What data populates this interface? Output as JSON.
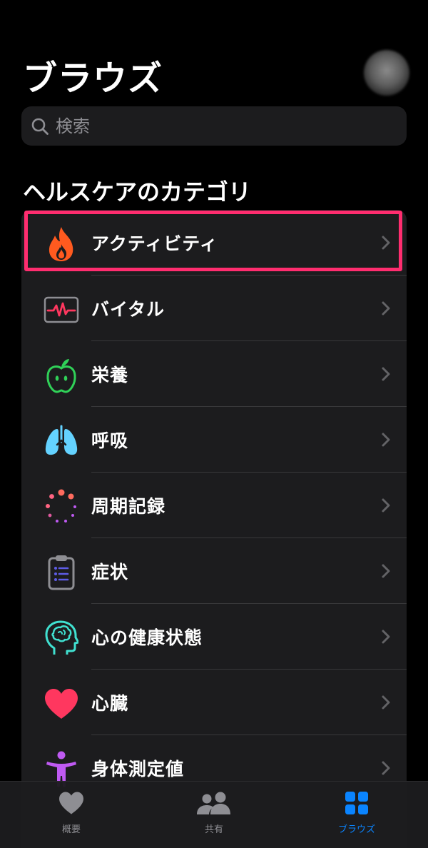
{
  "header": {
    "title": "ブラウズ"
  },
  "search": {
    "placeholder": "検索"
  },
  "section": {
    "title": "ヘルスケアのカテゴリ"
  },
  "categories": [
    {
      "label": "アクティビティ",
      "icon": "flame-icon",
      "color": "#ff5a1f"
    },
    {
      "label": "バイタル",
      "icon": "vitals-icon",
      "color": "#ff375f"
    },
    {
      "label": "栄養",
      "icon": "apple-icon",
      "color": "#30d158"
    },
    {
      "label": "呼吸",
      "icon": "lungs-icon",
      "color": "#64d2ff"
    },
    {
      "label": "周期記録",
      "icon": "cycle-tracking-icon",
      "color": "#ff6482"
    },
    {
      "label": "症状",
      "icon": "clipboard-list-icon",
      "color": "#5e5ce6"
    },
    {
      "label": "心の健康状態",
      "icon": "head-brain-icon",
      "color": "#40e0d0"
    },
    {
      "label": "心臓",
      "icon": "heart-icon",
      "color": "#ff375f"
    },
    {
      "label": "身体測定値",
      "icon": "person-icon",
      "color": "#bf5af2"
    }
  ],
  "tabbar": {
    "tabs": [
      {
        "label": "概要",
        "icon": "heart-icon",
        "active": false
      },
      {
        "label": "共有",
        "icon": "people-icon",
        "active": false
      },
      {
        "label": "ブラウズ",
        "icon": "grid-icon",
        "active": true
      }
    ]
  },
  "colors": {
    "accent": "#0a84ff",
    "highlight": "#ff2d6f",
    "row_background": "#1c1c1e"
  }
}
